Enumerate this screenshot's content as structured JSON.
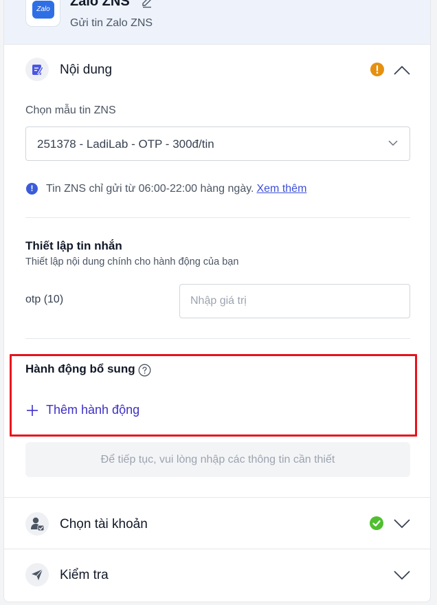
{
  "app": {
    "title": "Zalo ZNS",
    "subtitle": "Gửi tin Zalo ZNS",
    "logo_text": "Zalo"
  },
  "content_section": {
    "title": "Nội dung",
    "status": "warning",
    "expanded": true,
    "template_label": "Chọn mẫu tin ZNS",
    "template_value": "251378 - LadiLab - OTP - 300đ/tin",
    "info_text": "Tin ZNS chỉ gửi từ 06:00-22:00 hàng ngày.",
    "info_link": "Xem thêm",
    "message_setup": {
      "title": "Thiết lập tin nhắn",
      "subtitle": "Thiết lập nội dung chính cho hành động của bạn",
      "field_label": "otp (10)",
      "field_placeholder": "Nhập giá trị",
      "field_value": ""
    },
    "extra_actions": {
      "title": "Hành động bổ sung",
      "add_label": "Thêm hành động"
    },
    "notice": "Để tiếp tục, vui lòng nhập các thông tin cần thiết"
  },
  "account_section": {
    "title": "Chọn tài khoản",
    "status": "success",
    "expanded": false
  },
  "check_section": {
    "title": "Kiểm tra",
    "expanded": false
  },
  "colors": {
    "warning": "#e6900f",
    "success": "#4fbf2f",
    "accent": "#3c2fc7",
    "highlight": "#e8111c"
  },
  "icons": {
    "content": "edit-note-icon",
    "account": "user-check-icon",
    "check": "send-icon",
    "edit": "pencil-icon",
    "help": "question-circle-icon",
    "add": "plus-icon"
  }
}
